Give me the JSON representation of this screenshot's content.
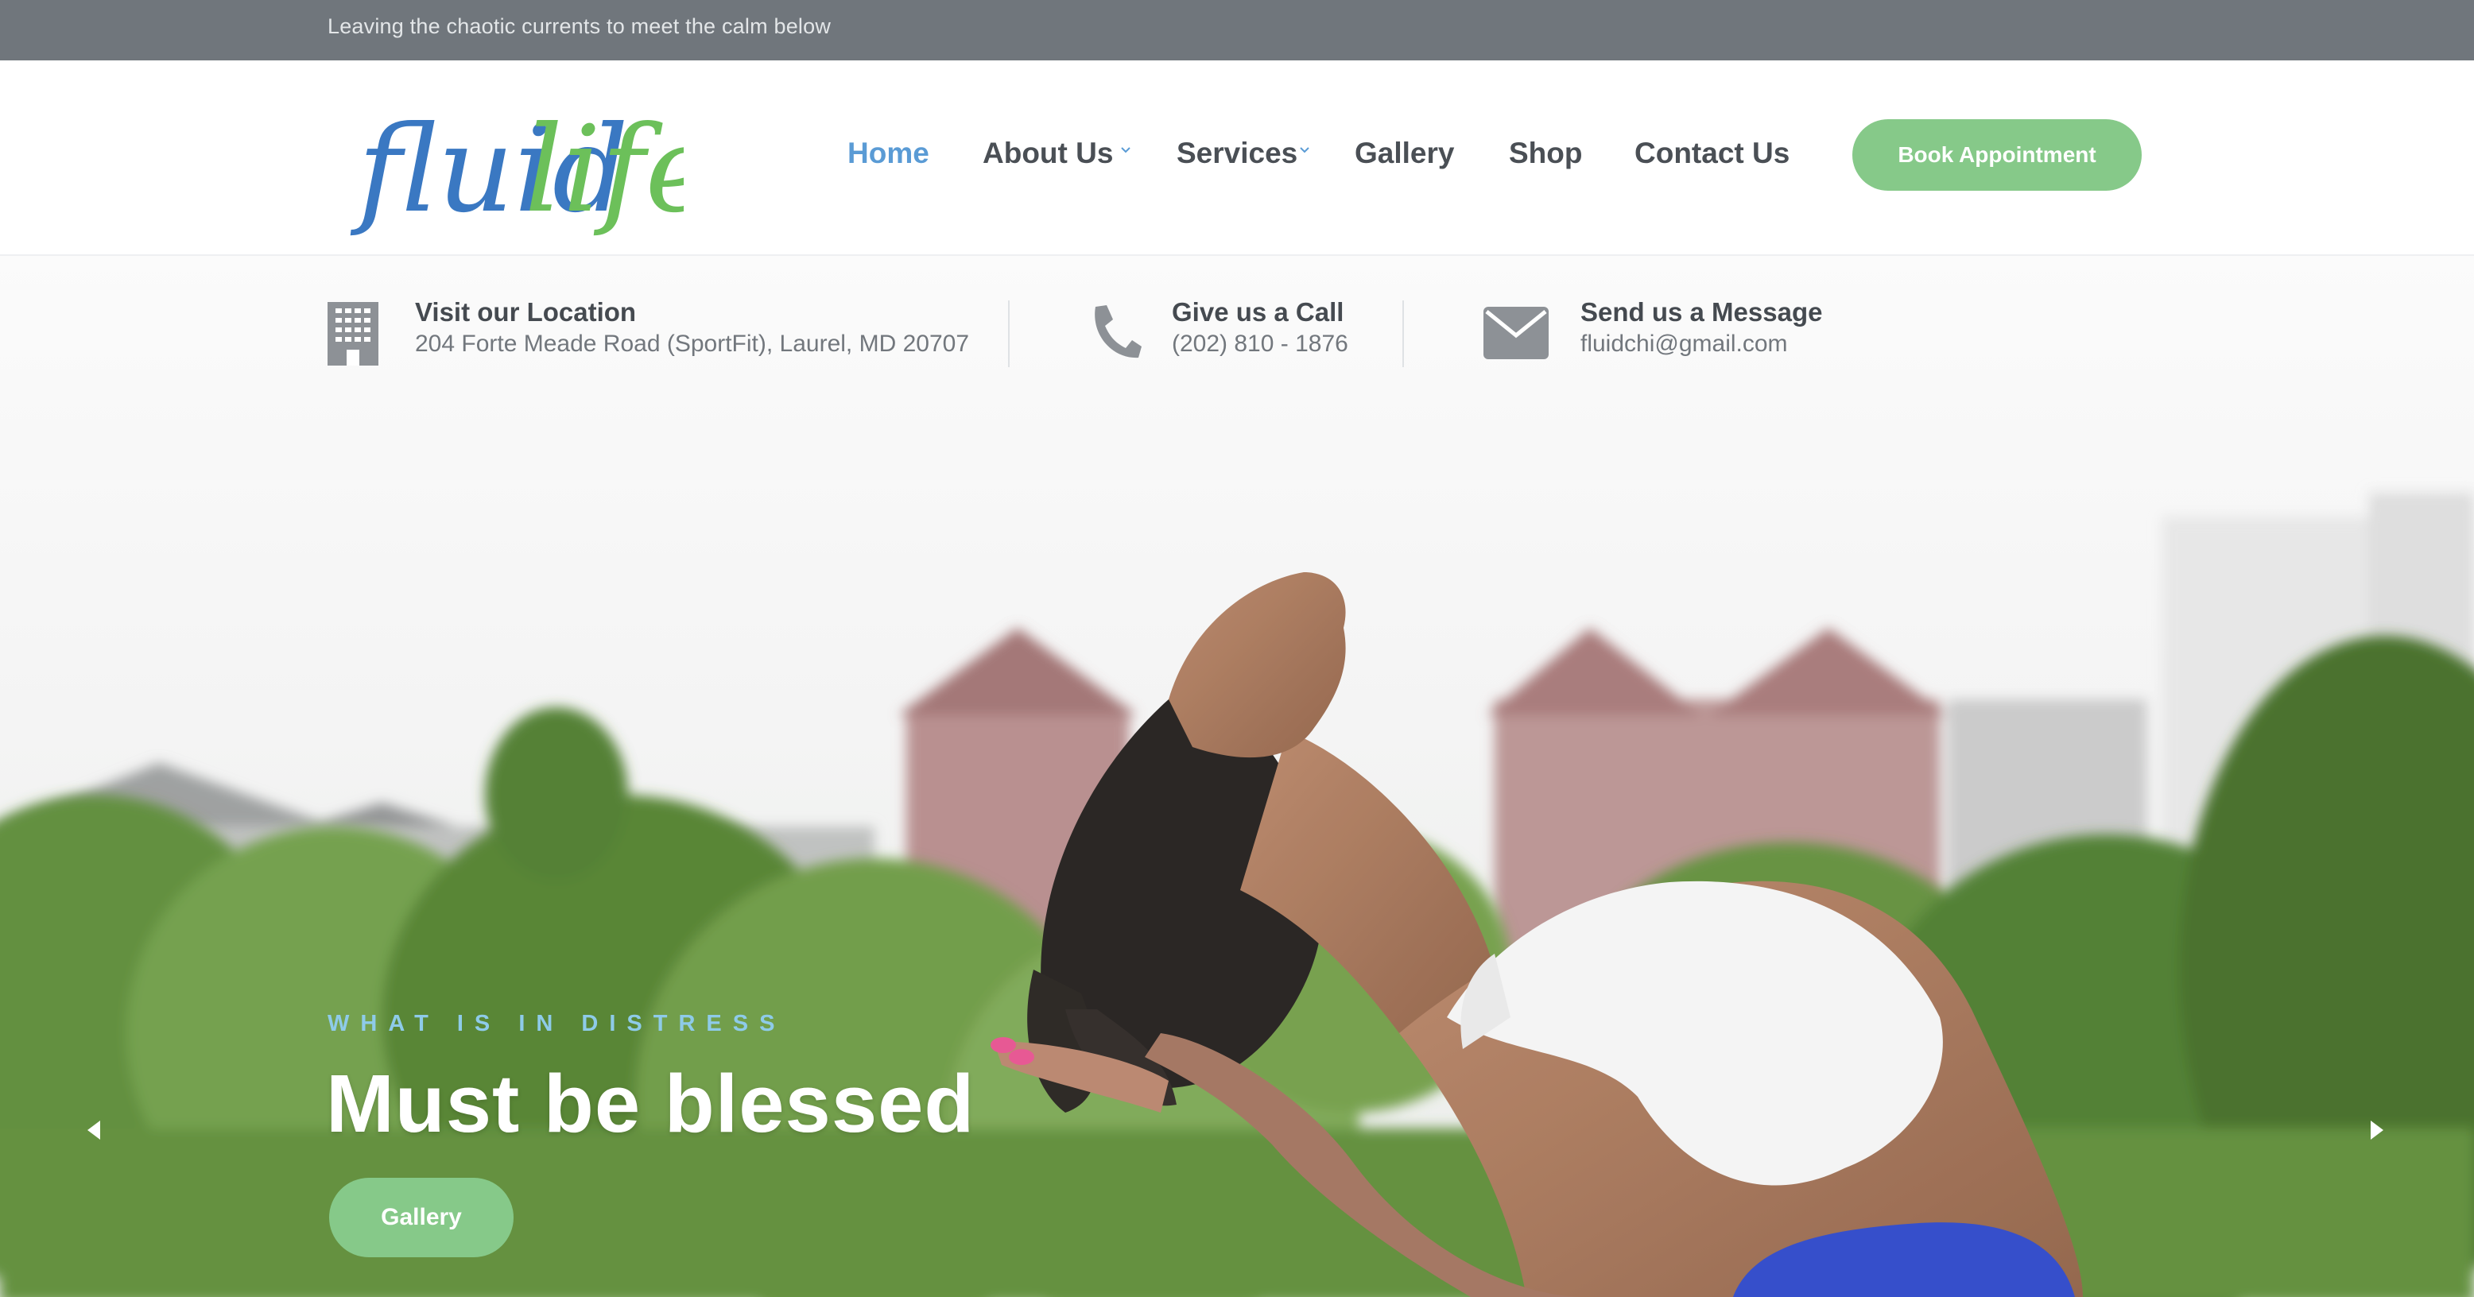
{
  "topbar": {
    "tagline": "Leaving the chaotic currents to meet the calm below"
  },
  "brand": {
    "logo_part1": "fluid",
    "logo_part2": "life",
    "color1": "#3a78c2",
    "color2": "#6cc05a"
  },
  "nav": {
    "items": [
      {
        "label": "Home",
        "active": true
      },
      {
        "label": "About Us",
        "has_dropdown": true
      },
      {
        "label": "Services",
        "has_dropdown": true
      },
      {
        "label": "Gallery"
      },
      {
        "label": "Shop"
      },
      {
        "label": "Contact Us"
      }
    ],
    "cta": "Book Appointment"
  },
  "info": {
    "location": {
      "title": "Visit our Location",
      "text": "204 Forte Meade Road (SportFit), Laurel, MD 20707",
      "icon": "building-icon"
    },
    "call": {
      "title": "Give us a Call",
      "text": "(202) 810 - 1876",
      "icon": "phone-icon"
    },
    "message": {
      "title": "Send us a Message",
      "text": "fluidchi@gmail.com",
      "icon": "envelope-icon"
    }
  },
  "hero": {
    "kicker": "WHAT IS IN DISTRESS",
    "headline": "Must be blessed",
    "button": "Gallery",
    "prev_icon": "arrow-left-icon",
    "next_icon": "arrow-right-icon"
  },
  "colors": {
    "accent": "#86c989",
    "nav_active": "#5a9bd5",
    "topbar": "#70767c",
    "kicker": "#8ecbe9"
  }
}
